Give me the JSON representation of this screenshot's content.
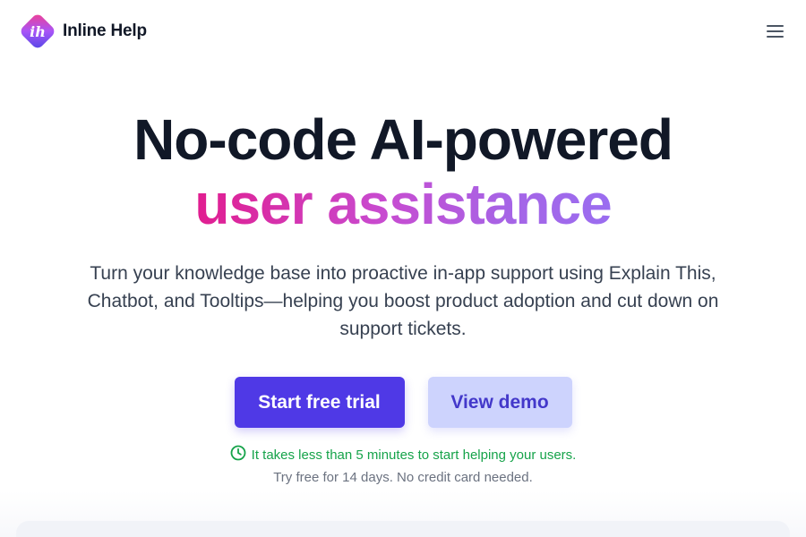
{
  "brand": {
    "name": "Inline Help",
    "logo_letters": "ih",
    "colors": {
      "logo_gradient": [
        "#f43f8e",
        "#a855f7",
        "#4f46e5"
      ],
      "accent": "#4f39e6",
      "secondary_button": "#cdd3fd",
      "success": "#16a34a"
    }
  },
  "header": {
    "menu_icon": "hamburger-menu-icon"
  },
  "hero": {
    "headline_line1": "No-code AI-powered",
    "headline_line2": "user assistance",
    "subtitle": "Turn your knowledge base into proactive in-app support using Explain This, Chatbot, and Tooltips—helping you boost product adoption and cut down on support tickets."
  },
  "cta": {
    "primary_label": "Start free trial",
    "secondary_label": "View demo"
  },
  "note": {
    "icon": "clock-icon",
    "line1": "It takes less than 5 minutes to start helping your users.",
    "line2": "Try free for 14 days. No credit card needed."
  }
}
